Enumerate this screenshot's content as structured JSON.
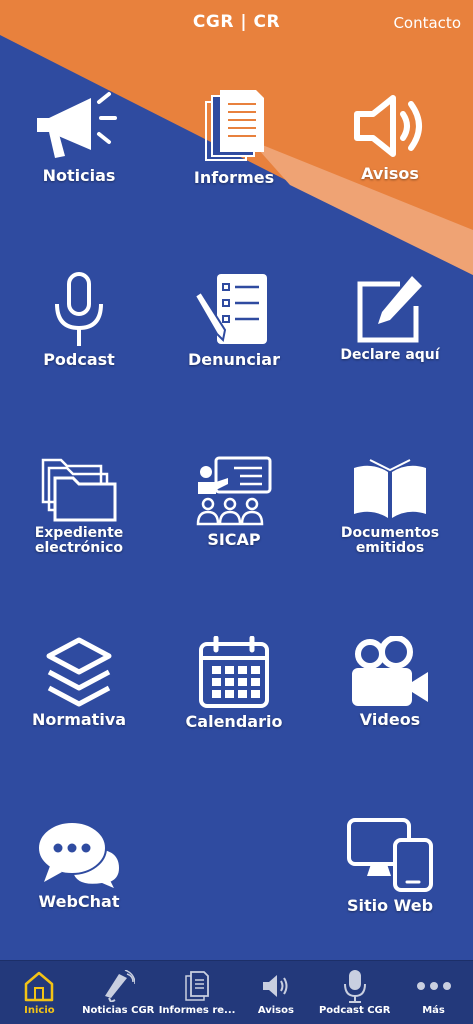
{
  "header": {
    "title": "CGR | CR",
    "contact_label": "Contacto"
  },
  "colors": {
    "blue": "#2f4ba0",
    "orange": "#e8813d",
    "light_orange": "#efa374",
    "tab_bg": "#23397b",
    "active_tab": "#f3c316"
  },
  "tiles": [
    {
      "label": "Noticias",
      "icon": "megaphone-icon"
    },
    {
      "label": "Informes",
      "icon": "documents-icon"
    },
    {
      "label": "Avisos",
      "icon": "speaker-icon"
    },
    {
      "label": "Podcast",
      "icon": "microphone-icon"
    },
    {
      "label": "Denunciar",
      "icon": "checklist-pen-icon"
    },
    {
      "label": "Declare aquí",
      "icon": "edit-icon"
    },
    {
      "label": "Expediente\nelectrónico",
      "icon": "folders-icon"
    },
    {
      "label": "SICAP",
      "icon": "training-icon"
    },
    {
      "label": "Documentos\nemitidos",
      "icon": "open-book-icon"
    },
    {
      "label": "Normativa",
      "icon": "layers-icon"
    },
    {
      "label": "Calendario",
      "icon": "calendar-icon"
    },
    {
      "label": "Videos",
      "icon": "video-camera-icon"
    },
    {
      "label": "WebChat",
      "icon": "chat-bubbles-icon"
    },
    {
      "label": "Sitio Web",
      "icon": "devices-icon"
    }
  ],
  "tabbar": {
    "items": [
      {
        "label": "Inicio",
        "icon": "home-icon",
        "active": true
      },
      {
        "label": "Noticias CGR",
        "icon": "megaphone-icon"
      },
      {
        "label": "Informes re...",
        "icon": "documents-icon"
      },
      {
        "label": "Avisos",
        "icon": "speaker-icon"
      },
      {
        "label": "Podcast CGR",
        "icon": "microphone-icon"
      },
      {
        "label": "Más",
        "icon": "more-dots-icon"
      }
    ]
  }
}
